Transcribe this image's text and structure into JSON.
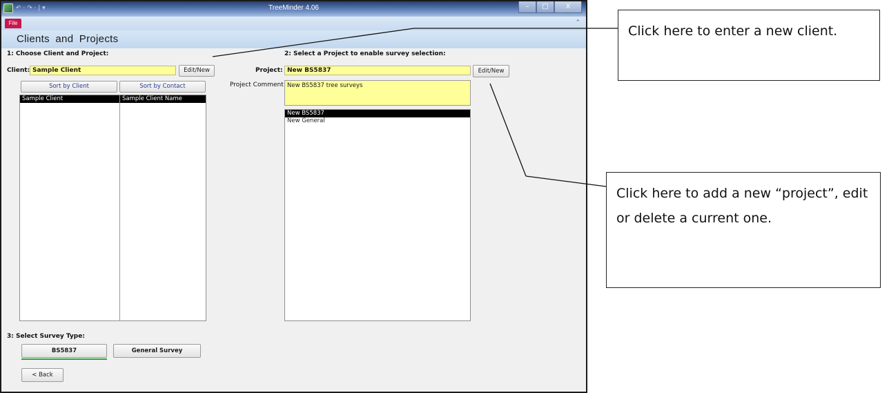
{
  "window": {
    "title": "TreeMinder 4.06",
    "file_tab": "File",
    "qat_glyphs": "↶ · ↷ · | ▾",
    "controls": [
      "–",
      "□",
      "X"
    ]
  },
  "page": {
    "title": "Clients and Projects"
  },
  "left": {
    "section1": "1: Choose Client and Project:",
    "client_label": "Client:",
    "client_value": "Sample Client",
    "edit_new": "Edit/New",
    "sort_by_client": "Sort by Client",
    "sort_by_contact": "Sort by Contact",
    "clients": [
      {
        "client": "Sample Client",
        "contact": "Sample Client Name",
        "selected": true
      }
    ]
  },
  "right": {
    "section2": "2: Select a Project to enable survey selection:",
    "project_label": "Project:",
    "project_value": "New BS5837",
    "edit_new": "Edit/New",
    "comment_label": "Project Comment",
    "comment_value": "New BS5837 tree surveys",
    "projects": [
      {
        "name": "New BS5837",
        "selected": true
      },
      {
        "name": "New General",
        "selected": false
      }
    ]
  },
  "survey": {
    "section3": "3: Select Survey Type:",
    "bs5837": "BS5837",
    "general": "General Survey",
    "back": "< Back"
  },
  "callouts": {
    "client": "Click here to enter a new client.",
    "project": "Click here to add a new “project”, edit or delete a current one."
  },
  "colors": {
    "input_highlight": "#ffff99",
    "selected_row": "#000000",
    "file_tab": "#c8174e",
    "active_survey_underline": "#2fa33a",
    "header_band": "#c8dbf0"
  }
}
